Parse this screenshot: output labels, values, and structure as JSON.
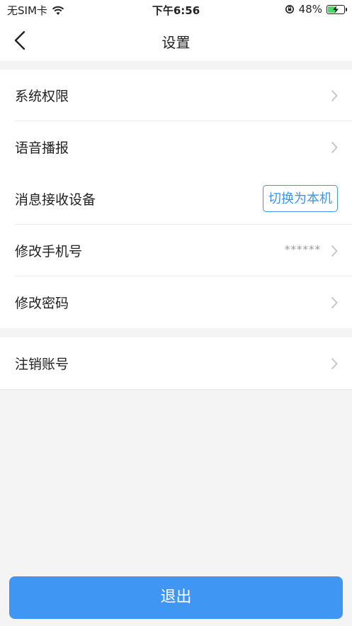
{
  "status_bar": {
    "carrier": "无SIM卡",
    "time": "下午6:56",
    "battery_percent": "48%",
    "battery_level": 0.48,
    "icons": [
      "wifi-icon",
      "orientation-lock-icon",
      "battery-charging-icon"
    ]
  },
  "nav": {
    "title": "设置",
    "back_icon": "chevron-left-icon"
  },
  "settings": {
    "group1": [
      {
        "label": "系统权限",
        "type": "link"
      },
      {
        "label": "语音播报",
        "type": "link"
      },
      {
        "label": "消息接收设备",
        "type": "button",
        "button_label": "切换为本机"
      },
      {
        "label": "修改手机号",
        "type": "link",
        "value": "******"
      },
      {
        "label": "修改密码",
        "type": "link"
      }
    ],
    "group2": [
      {
        "label": "注销账号",
        "type": "link"
      }
    ]
  },
  "logout_label": "退出",
  "colors": {
    "accent": "#3f97f3",
    "background": "#f4f4f4",
    "chevron": "#c4c4c4"
  }
}
